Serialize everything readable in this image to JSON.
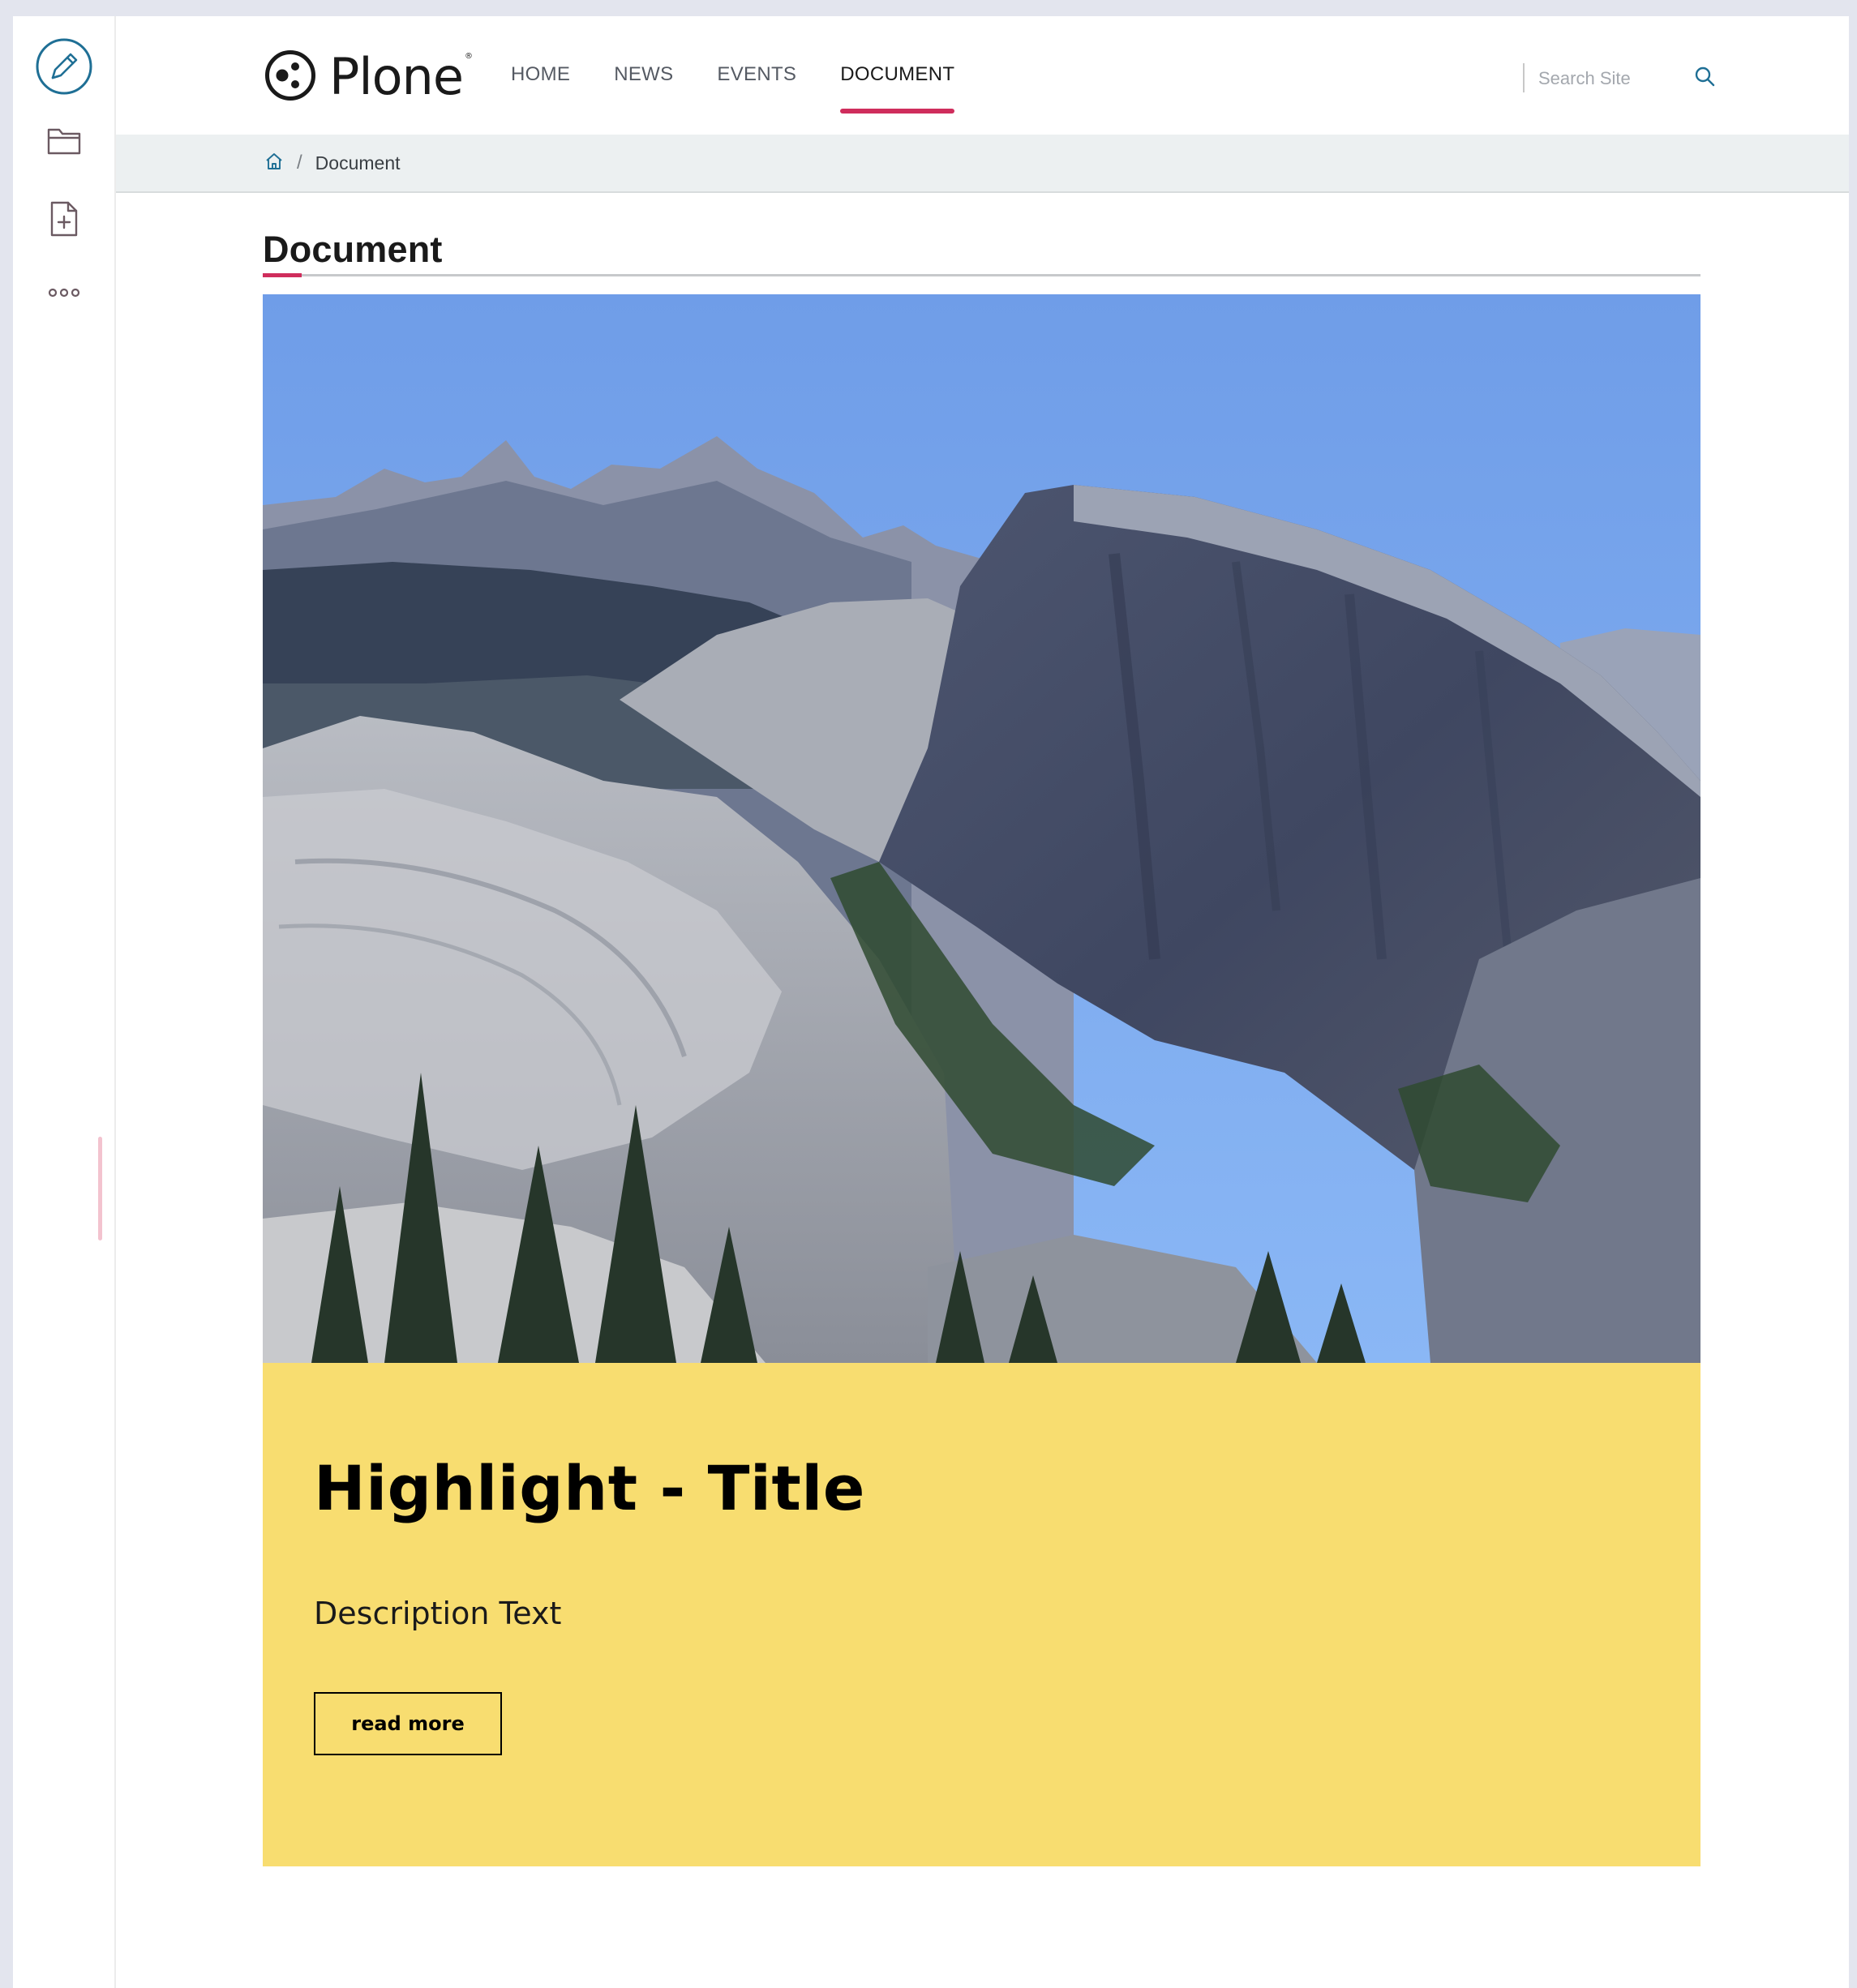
{
  "toolbar": {
    "items": [
      {
        "icon": "pencil-icon",
        "label": "Edit"
      },
      {
        "icon": "folder-icon",
        "label": "Contents"
      },
      {
        "icon": "add-document-icon",
        "label": "Add"
      },
      {
        "icon": "more-icon",
        "label": "More"
      }
    ]
  },
  "header": {
    "logo_text": "Plone",
    "logo_mark": "®",
    "nav": [
      "HOME",
      "NEWS",
      "EVENTS",
      "DOCUMENT"
    ],
    "active_nav": "DOCUMENT",
    "search_placeholder": "Search Site"
  },
  "breadcrumb": {
    "items": [
      "Document"
    ]
  },
  "page": {
    "title": "Document"
  },
  "highlight": {
    "title": "Highlight - Title",
    "description": "Description Text",
    "button_label": "read more",
    "background": "#f8dd70"
  },
  "colors": {
    "accent": "#cf2d5c",
    "toolbar_icon": "#00769b",
    "breadcrumb_bg": "#ecf0f1"
  }
}
